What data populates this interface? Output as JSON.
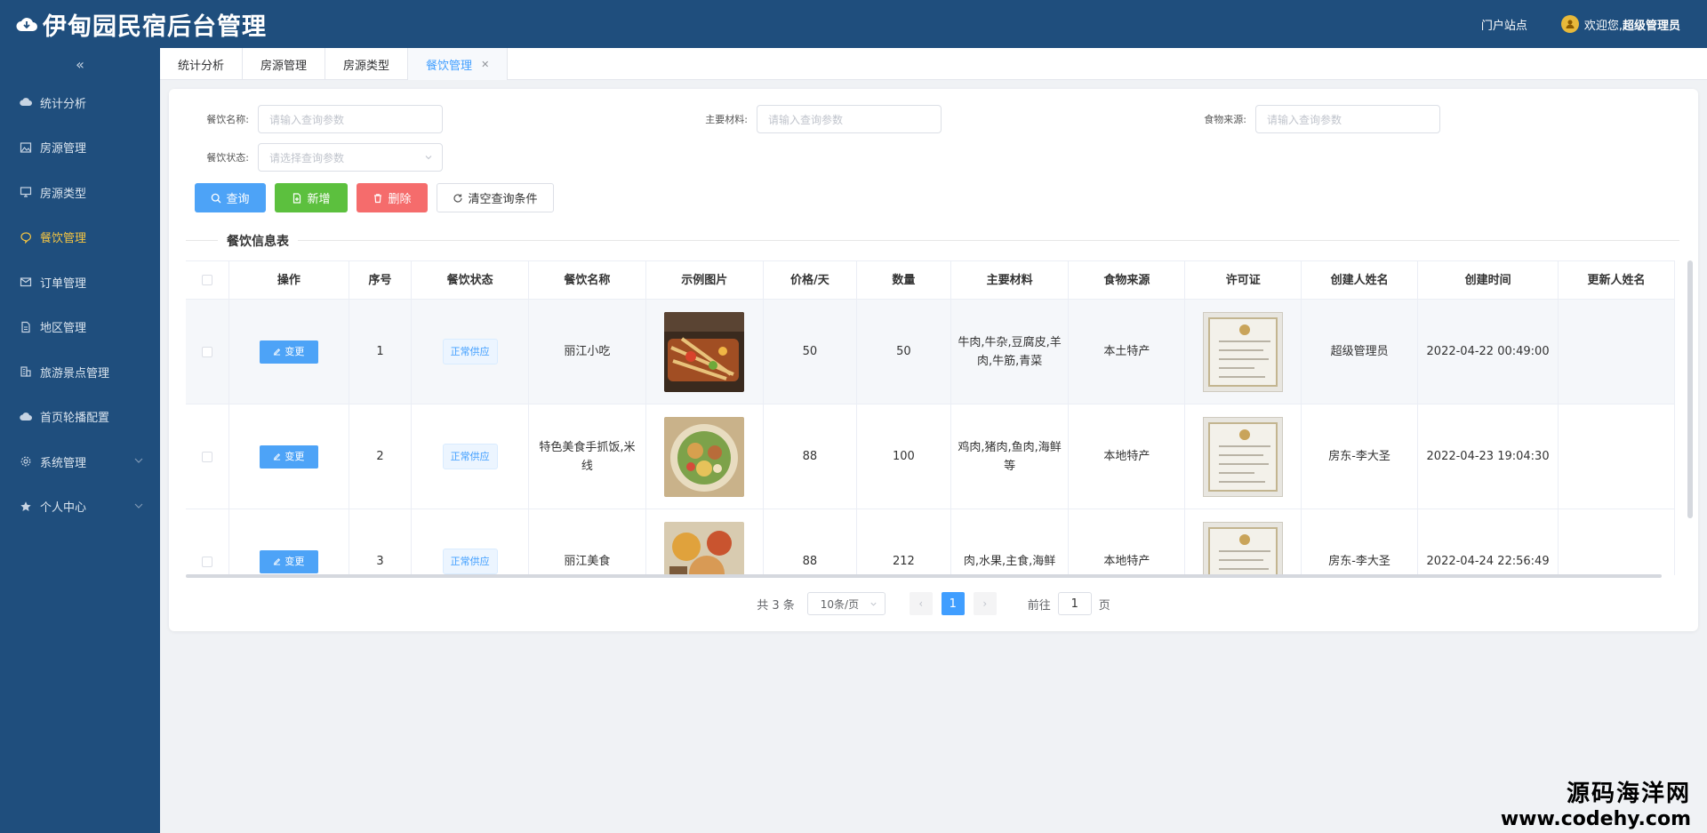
{
  "header": {
    "title": "伊甸园民宿后台管理",
    "portal": "门户站点",
    "welcome_prefix": "欢迎您,",
    "user": "超级管理员"
  },
  "sidebar": {
    "collapse": "«",
    "items": [
      {
        "label": "统计分析",
        "icon": "cloud-icon"
      },
      {
        "label": "房源管理",
        "icon": "image-icon"
      },
      {
        "label": "房源类型",
        "icon": "monitor-icon"
      },
      {
        "label": "餐饮管理",
        "icon": "chat-icon"
      },
      {
        "label": "订单管理",
        "icon": "mail-icon"
      },
      {
        "label": "地区管理",
        "icon": "document-icon"
      },
      {
        "label": "旅游景点管理",
        "icon": "building-icon"
      },
      {
        "label": "首页轮播配置",
        "icon": "cloud-icon"
      },
      {
        "label": "系统管理",
        "icon": "gear-icon"
      },
      {
        "label": "个人中心",
        "icon": "star-icon"
      }
    ]
  },
  "tabs": [
    "统计分析",
    "房源管理",
    "房源类型",
    "餐饮管理"
  ],
  "search": {
    "name_label": "餐饮名称:",
    "name_placeholder": "请输入查询参数",
    "material_label": "主要材料:",
    "material_placeholder": "请输入查询参数",
    "source_label": "食物来源:",
    "source_placeholder": "请输入查询参数",
    "status_label": "餐饮状态:",
    "status_placeholder": "请选择查询参数"
  },
  "buttons": {
    "query": "查询",
    "add": "新增",
    "delete": "删除",
    "clear": "清空查询条件"
  },
  "table": {
    "title": "餐饮信息表",
    "headers": [
      "操作",
      "序号",
      "餐饮状态",
      "餐饮名称",
      "示例图片",
      "价格/天",
      "数量",
      "主要材料",
      "食物来源",
      "许可证",
      "创建人姓名",
      "创建时间",
      "更新人姓名"
    ],
    "change_label": "变更",
    "rows": [
      {
        "index": "1",
        "status": "正常供应",
        "name": "丽江小吃",
        "price": "50",
        "qty": "50",
        "material": "牛肉,牛杂,豆腐皮,羊肉,牛筋,青菜",
        "source": "本土特产",
        "creator": "超级管理员",
        "created": "2022-04-22 00:49:00",
        "updater": ""
      },
      {
        "index": "2",
        "status": "正常供应",
        "name": "特色美食手抓饭,米线",
        "price": "88",
        "qty": "100",
        "material": "鸡肉,猪肉,鱼肉,海鲜等",
        "source": "本地特产",
        "creator": "房东-李大圣",
        "created": "2022-04-23 19:04:30",
        "updater": ""
      },
      {
        "index": "3",
        "status": "正常供应",
        "name": "丽江美食",
        "price": "88",
        "qty": "212",
        "material": "肉,水果,主食,海鲜",
        "source": "本地特产",
        "creator": "房东-李大圣",
        "created": "2022-04-24 22:56:49",
        "updater": ""
      }
    ]
  },
  "pagination": {
    "total": "共 3 条",
    "size": "10条/页",
    "current": "1",
    "goto_prefix": "前往",
    "goto_value": "1",
    "goto_suffix": "页"
  },
  "watermark": {
    "line1": "源码海洋网",
    "line2": "www.codehy.com"
  },
  "colors": {
    "sidebar": "#1f4e7d",
    "primary": "#409eff",
    "success": "#5cc03e",
    "danger": "#f56c6c",
    "active_menu": "#f5c542"
  }
}
